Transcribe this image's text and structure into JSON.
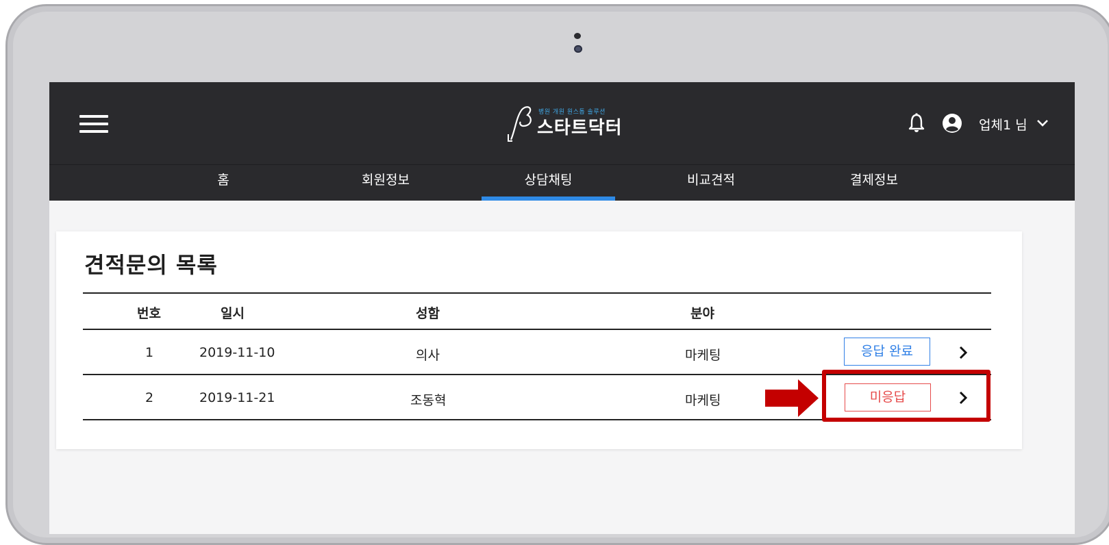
{
  "app": {
    "logo_tagline": "병원 개원 원스톱 솔루션",
    "logo_name": "스타트닥터",
    "user_name": "업체1 님"
  },
  "nav": {
    "items": [
      {
        "label": "홈"
      },
      {
        "label": "회원정보"
      },
      {
        "label": "상담채팅",
        "active": true
      },
      {
        "label": "비교견적"
      },
      {
        "label": "결제정보"
      }
    ]
  },
  "page": {
    "title": "견적문의 목록"
  },
  "table": {
    "headers": [
      "번호",
      "일시",
      "성함",
      "분야"
    ],
    "rows": [
      {
        "no": "1",
        "date": "2019-11-10",
        "name": "의사",
        "field": "마케팅",
        "status": "응답 완료",
        "status_type": "done"
      },
      {
        "no": "2",
        "date": "2019-11-21",
        "name": "조동혁",
        "field": "마케팅",
        "status": "미응답",
        "status_type": "pending"
      }
    ]
  },
  "colors": {
    "header_bg": "#2a2a2d",
    "accent_blue": "#2f8ae6",
    "status_done": "#2f7fe6",
    "status_pending": "#e64a4a",
    "annotation_red": "#c40000"
  },
  "icons": [
    "hamburger-menu-icon",
    "bell-icon",
    "user-circle-icon",
    "chevron-down-icon",
    "chevron-right-icon",
    "arrow-right-icon"
  ]
}
